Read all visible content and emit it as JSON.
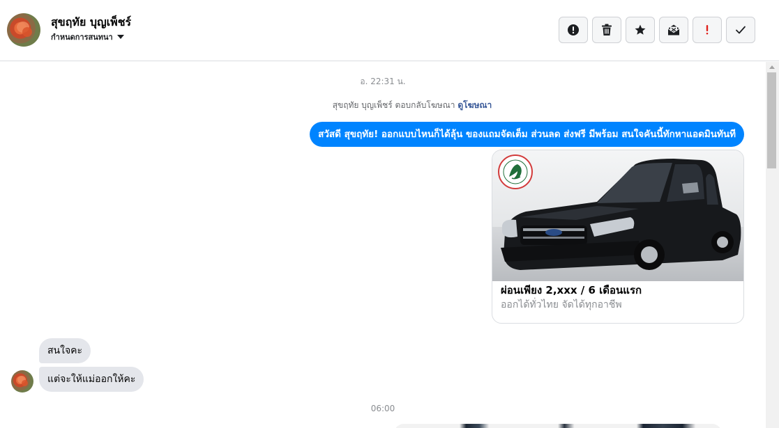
{
  "header": {
    "contact_name": "สุขฤทัย บุญเพ็ชร์",
    "subtitle": "กำหนดการสนทนา",
    "toolbar": [
      {
        "name": "report-button",
        "icon": "exclamation-circle-icon"
      },
      {
        "name": "delete-button",
        "icon": "trash-icon"
      },
      {
        "name": "star-button",
        "icon": "star-icon"
      },
      {
        "name": "mark-unread-button",
        "icon": "envelope-open-icon"
      },
      {
        "name": "mark-important-button",
        "icon": "exclamation-icon"
      },
      {
        "name": "mark-done-button",
        "icon": "checkmark-icon"
      }
    ]
  },
  "conversation": {
    "timestamp_1": "อ. 22:31 น.",
    "ad_reply_text": "สุขฤทัย บุญเพ็ชร์ ตอบกลับโฆษณา",
    "ad_reply_link": "ดูโฆษณา",
    "outgoing_message": "สวัสดี สุขฤทัย! ออกแบบไหนก็ได้ลุ้น ของแถมจัดเต็ม ส่วนลด ส่งฟรี มีพร้อม สนใจคันนี้ทักหาแอดมินทันที",
    "ad_card": {
      "title": "ผ่อนเพียง 2,xxx / 6 เดือนแรก",
      "description": "ออกได้ทั่วไทย จัดได้ทุกอาชีพ"
    },
    "incoming_messages": [
      "สนใจคะ",
      "แต่จะให้แม่ออกให้คะ"
    ],
    "timestamp_2": "06:00"
  },
  "colors": {
    "outgoing_bubble": "#0084ff",
    "incoming_bubble": "#e4e6eb",
    "link": "#385898",
    "important": "#e0201b"
  }
}
